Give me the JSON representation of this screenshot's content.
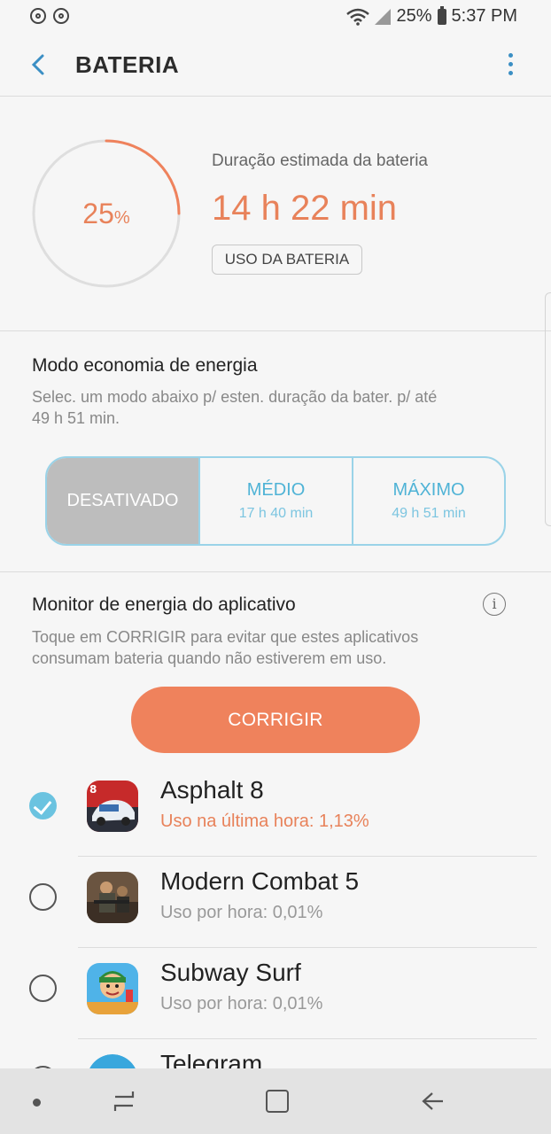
{
  "status_bar": {
    "battery_percent": "25%",
    "time": "5:37 PM"
  },
  "header": {
    "title": "BATERIA"
  },
  "battery": {
    "level": 25,
    "level_number": "25",
    "level_unit": "%",
    "estimate_label": "Duração estimada da bateria",
    "estimate_value": "14 h 22 min",
    "usage_button": "USO DA BATERIA"
  },
  "power_saving": {
    "title": "Modo economia de energia",
    "description": "Selec. um modo abaixo p/ esten. duração da bater. p/ até 49 h 51 min.",
    "modes": [
      {
        "label": "DESATIVADO",
        "time": "",
        "selected": true
      },
      {
        "label": "MÉDIO",
        "time": "17 h 40 min",
        "selected": false
      },
      {
        "label": "MÁXIMO",
        "time": "49 h 51 min",
        "selected": false
      }
    ]
  },
  "monitor": {
    "title": "Monitor de energia do aplicativo",
    "info_icon": "i",
    "description": "Toque em CORRIGIR para evitar que estes aplicativos consumam bateria quando não estiverem em uso.",
    "fix_button": "CORRIGIR",
    "apps": [
      {
        "name": "Asphalt 8",
        "usage": "Uso na última hora: 1,13%",
        "checked": true
      },
      {
        "name": "Modern Combat 5",
        "usage": "Uso por hora: 0,01%",
        "checked": false
      },
      {
        "name": "Subway Surf",
        "usage": "Uso por hora: 0,01%",
        "checked": false
      },
      {
        "name": "Telegram",
        "usage": "",
        "checked": false
      }
    ]
  },
  "colors": {
    "accent_orange": "#ef825c",
    "accent_blue": "#4fb3d6",
    "check_blue": "#6bc3e0"
  }
}
